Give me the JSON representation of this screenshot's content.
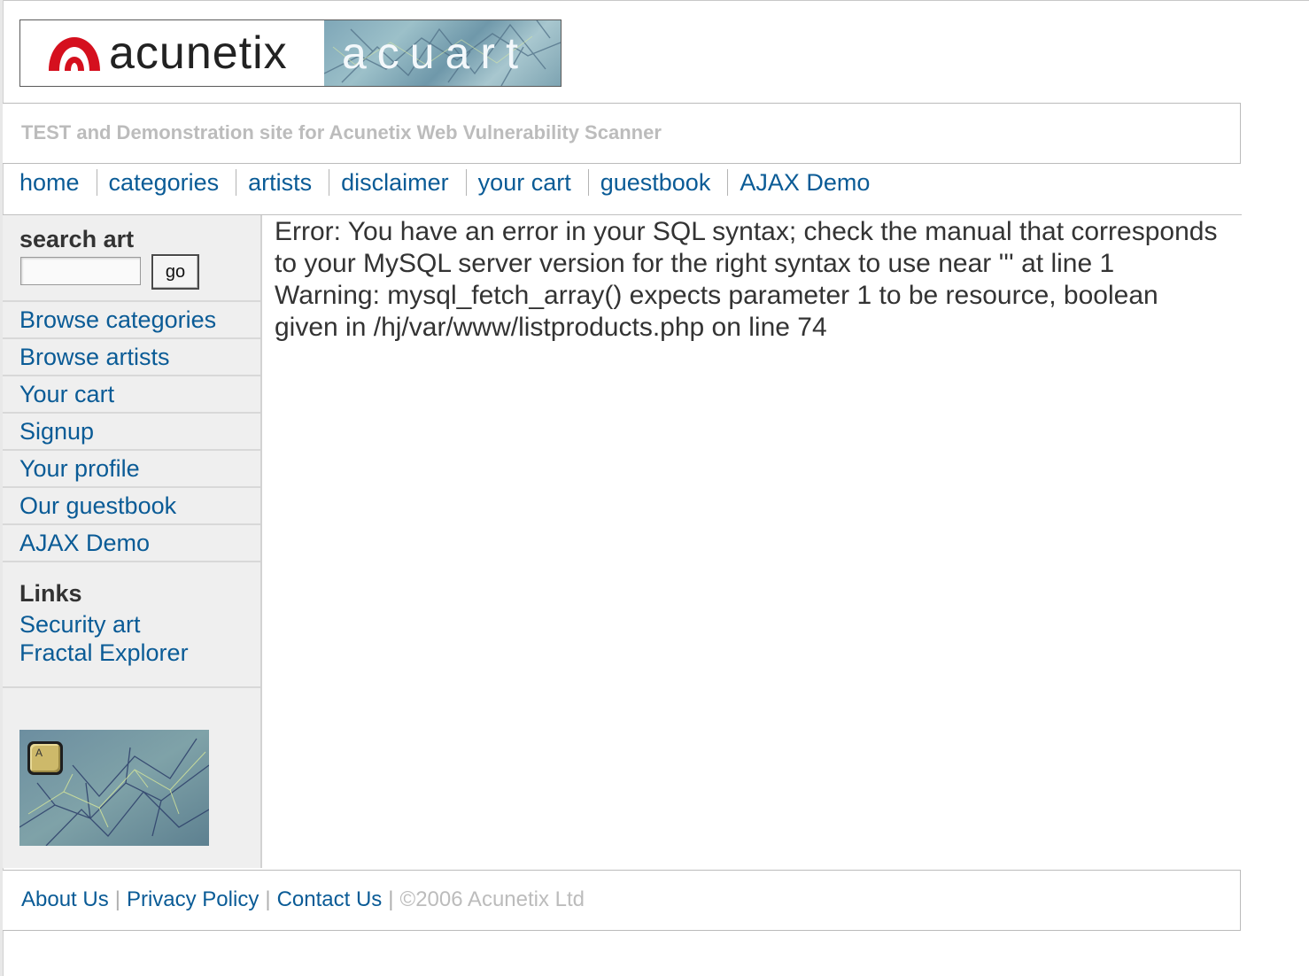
{
  "header": {
    "logo_left_text": "acunetix",
    "logo_right_text": "acuart",
    "tagline": "TEST and Demonstration site for Acunetix Web Vulnerability Scanner"
  },
  "topnav": [
    {
      "label": "home"
    },
    {
      "label": "categories"
    },
    {
      "label": "artists"
    },
    {
      "label": "disclaimer"
    },
    {
      "label": "your cart"
    },
    {
      "label": "guestbook"
    },
    {
      "label": "AJAX Demo"
    }
  ],
  "sidebar": {
    "search_title": "search art",
    "search_value": "",
    "go_label": "go",
    "menu": [
      {
        "label": "Browse categories"
      },
      {
        "label": "Browse artists"
      },
      {
        "label": "Your cart"
      },
      {
        "label": "Signup"
      },
      {
        "label": "Your profile"
      },
      {
        "label": "Our guestbook"
      },
      {
        "label": "AJAX Demo"
      }
    ],
    "links_title": "Links",
    "links": [
      {
        "label": "Security art"
      },
      {
        "label": "Fractal Explorer"
      }
    ],
    "banner_key_letter": "A"
  },
  "main": {
    "error_text": "Error: You have an error in your SQL syntax; check the manual that corresponds to your MySQL server version for the right syntax to use near ''' at line 1 Warning: mysql_fetch_array() expects parameter 1 to be resource, boolean given in /hj/var/www/listproducts.php on line 74"
  },
  "footer": {
    "about": "About Us",
    "privacy": "Privacy Policy",
    "contact": "Contact Us",
    "separator": "|",
    "copyright": "©2006 Acunetix Ltd"
  },
  "colors": {
    "link": "#0a5b96",
    "tagline": "#bcbcbc",
    "sidebar_bg": "#efefef",
    "logo_red": "#d5101e"
  }
}
